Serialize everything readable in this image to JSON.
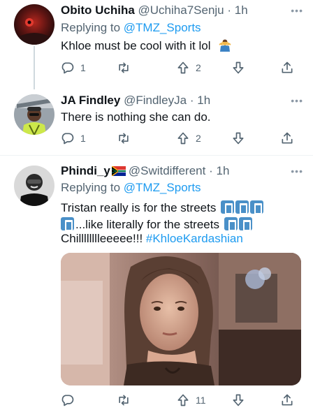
{
  "tweets": [
    {
      "name": "Obito Uchiha",
      "handle": "@Uchiha7Senju",
      "dot": "·",
      "time": "1h",
      "replying_prefix": "Replying to ",
      "replying_to": "@TMZ_Sports",
      "text": "Khloe must be cool with it lol",
      "emoji": "person-shrugging-icon",
      "replies": "1",
      "retweets": "",
      "likes": "2"
    },
    {
      "name": "JA Findley",
      "handle": "@FindleyJa",
      "dot": "·",
      "time": "1h",
      "text": "There is nothing she can do.",
      "replies": "1",
      "retweets": "",
      "likes": "2"
    },
    {
      "name": "Phindi_y",
      "flag": "south-africa-flag-icon",
      "handle": "@Switdifferent",
      "dot": "·",
      "time": "1h",
      "replying_prefix": "Replying to ",
      "replying_to": "@TMZ_Sports",
      "line1": "Tristan really is for the streets",
      "line2": "...like literally for the streets",
      "line3_text": "Chilllllllleeeee!!! ",
      "hashtag": "#KhloeKardashian",
      "emoji": "litter-in-bin-icon",
      "replies": "",
      "retweets": "",
      "likes": "11"
    }
  ],
  "more_label": "•••",
  "colors": {
    "accent": "#1d9bf0",
    "secondary_text": "#536471",
    "divider": "#eff3f4"
  }
}
